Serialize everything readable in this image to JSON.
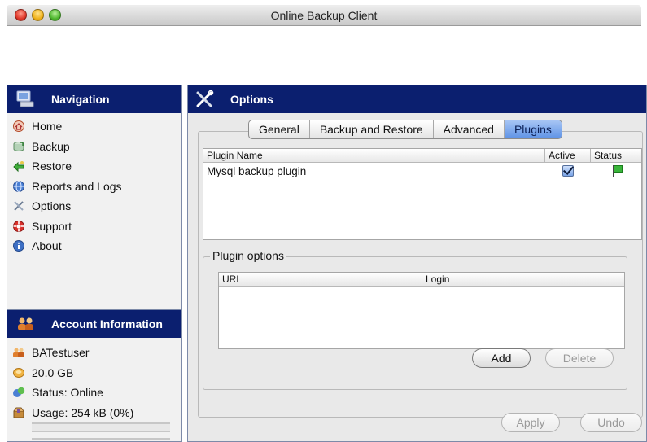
{
  "window": {
    "title": "Online Backup Client"
  },
  "navigation": {
    "header": "Navigation",
    "items": [
      {
        "label": "Home",
        "icon": "home-icon"
      },
      {
        "label": "Backup",
        "icon": "backup-icon"
      },
      {
        "label": "Restore",
        "icon": "restore-icon"
      },
      {
        "label": "Reports and Logs",
        "icon": "reports-icon"
      },
      {
        "label": "Options",
        "icon": "options-icon"
      },
      {
        "label": "Support",
        "icon": "support-icon"
      },
      {
        "label": "About",
        "icon": "about-icon"
      }
    ]
  },
  "account": {
    "header": "Account Information",
    "user": "BATestuser",
    "quota": "20.0 GB",
    "status": "Status: Online",
    "usage": "Usage: 254 kB (0%)",
    "usage_fraction": 0.0
  },
  "options": {
    "header": "Options",
    "tabs": [
      {
        "label": "General",
        "active": false
      },
      {
        "label": "Backup and Restore",
        "active": false
      },
      {
        "label": "Advanced",
        "active": false
      },
      {
        "label": "Plugins",
        "active": true
      }
    ],
    "plugin_table": {
      "columns": {
        "name": "Plugin Name",
        "active": "Active",
        "status": "Status"
      },
      "rows": [
        {
          "name": "Mysql backup plugin",
          "active": true,
          "status": "green-flag-icon"
        }
      ]
    },
    "plugin_options": {
      "legend": "Plugin options",
      "columns": {
        "url": "URL",
        "login": "Login"
      },
      "add_label": "Add",
      "delete_label": "Delete"
    },
    "apply_label": "Apply",
    "undo_label": "Undo"
  },
  "colors": {
    "header_bg": "#0b1f6f",
    "tab_active": "#5f93e6",
    "status_ok": "#39b53a"
  }
}
